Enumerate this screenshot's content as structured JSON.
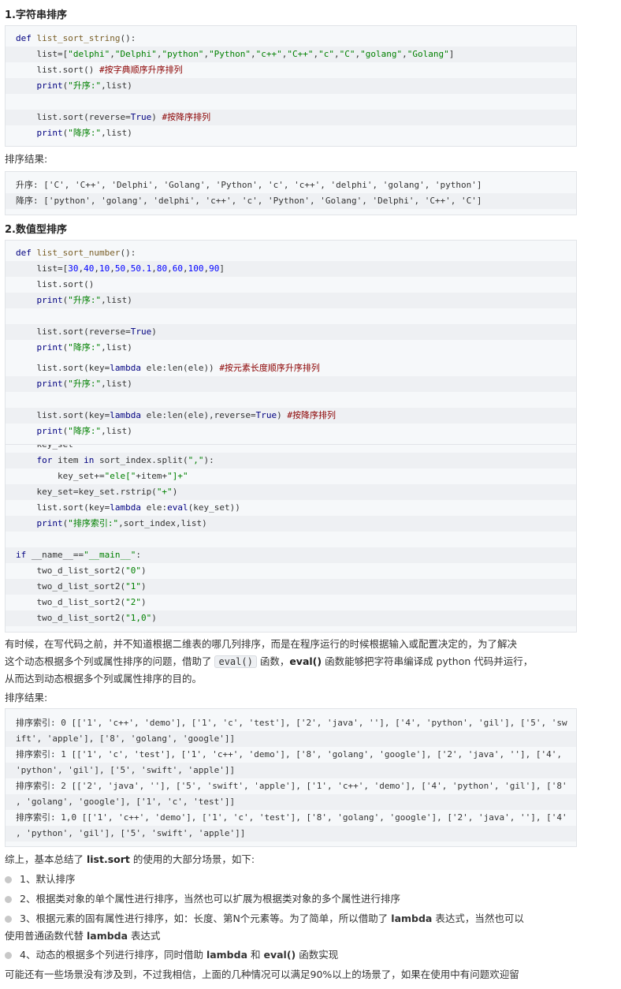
{
  "heading1": "1.字符串排序",
  "code1": [
    {
      "parts": [
        [
          "kw",
          "def "
        ],
        [
          "fn",
          "list_sort_string"
        ],
        [
          "",
          "():"
        ]
      ]
    },
    {
      "parts": [
        [
          "",
          "    list=["
        ],
        [
          "str",
          "\"delphi\""
        ],
        [
          "",
          ","
        ],
        [
          "str",
          "\"Delphi\""
        ],
        [
          "",
          ","
        ],
        [
          "str",
          "\"python\""
        ],
        [
          "",
          ","
        ],
        [
          "str",
          "\"Python\""
        ],
        [
          "",
          ","
        ],
        [
          "str",
          "\"c++\""
        ],
        [
          "",
          ","
        ],
        [
          "str",
          "\"C++\""
        ],
        [
          "",
          ","
        ],
        [
          "str",
          "\"c\""
        ],
        [
          "",
          ","
        ],
        [
          "str",
          "\"C\""
        ],
        [
          "",
          ","
        ],
        [
          "str",
          "\"golang\""
        ],
        [
          "",
          ","
        ],
        [
          "str",
          "\"Golang\""
        ],
        [
          "",
          "]"
        ]
      ]
    },
    {
      "parts": [
        [
          "",
          "    list.sort() "
        ],
        [
          "com",
          "#按字典顺序升序排列"
        ]
      ]
    },
    {
      "parts": [
        [
          "bi",
          "    print"
        ],
        [
          "",
          "("
        ],
        [
          "str",
          "\"升序:\""
        ],
        [
          "",
          ",list)"
        ]
      ]
    },
    {
      "parts": [
        [
          "",
          ""
        ]
      ]
    },
    {
      "parts": [
        [
          "",
          "    list.sort(reverse="
        ],
        [
          "kw",
          "True"
        ],
        [
          "",
          ") "
        ],
        [
          "com",
          "#按降序排列"
        ]
      ]
    },
    {
      "parts": [
        [
          "bi",
          "    print"
        ],
        [
          "",
          "("
        ],
        [
          "str",
          "\"降序:\""
        ],
        [
          "",
          ",list)"
        ]
      ]
    }
  ],
  "result_label1": "排序结果:",
  "output1": [
    "升序: ['C', 'C++', 'Delphi', 'Golang', 'Python', 'c', 'c++', 'delphi', 'golang', 'python']",
    "降序: ['python', 'golang', 'delphi', 'c++', 'c', 'Python', 'Golang', 'Delphi', 'C++', 'C']"
  ],
  "heading2": "2.数值型排序",
  "code2": [
    {
      "parts": [
        [
          "kw",
          "def "
        ],
        [
          "fn",
          "list_sort_number"
        ],
        [
          "",
          "():"
        ]
      ]
    },
    {
      "parts": [
        [
          "",
          "    list=["
        ],
        [
          "num",
          "30"
        ],
        [
          "",
          ","
        ],
        [
          "num",
          "40"
        ],
        [
          "",
          ","
        ],
        [
          "num",
          "10"
        ],
        [
          "",
          ","
        ],
        [
          "num",
          "50"
        ],
        [
          "",
          ","
        ],
        [
          "num",
          "50.1"
        ],
        [
          "",
          ","
        ],
        [
          "num",
          "80"
        ],
        [
          "",
          ","
        ],
        [
          "num",
          "60"
        ],
        [
          "",
          ","
        ],
        [
          "num",
          "100"
        ],
        [
          "",
          ","
        ],
        [
          "num",
          "90"
        ],
        [
          "",
          "]"
        ]
      ]
    },
    {
      "parts": [
        [
          "",
          "    list.sort()"
        ]
      ]
    },
    {
      "parts": [
        [
          "bi",
          "    print"
        ],
        [
          "",
          "("
        ],
        [
          "str",
          "\"升序:\""
        ],
        [
          "",
          ",list)"
        ]
      ]
    },
    {
      "parts": [
        [
          "",
          ""
        ]
      ]
    },
    {
      "parts": [
        [
          "",
          "    list.sort(reverse="
        ],
        [
          "kw",
          "True"
        ],
        [
          "",
          ")"
        ]
      ]
    },
    {
      "parts": [
        [
          "bi",
          "    print"
        ],
        [
          "",
          "("
        ],
        [
          "str",
          "\"降序:\""
        ],
        [
          "",
          ",list)"
        ]
      ]
    }
  ],
  "code2b": [
    {
      "parts": [
        [
          "",
          "    list.sort(key="
        ],
        [
          "kw",
          "lambda"
        ],
        [
          "",
          " ele:len(ele)) "
        ],
        [
          "com",
          "#按元素长度顺序升序排列"
        ]
      ]
    },
    {
      "parts": [
        [
          "bi",
          "    print"
        ],
        [
          "",
          "("
        ],
        [
          "str",
          "\"升序:\""
        ],
        [
          "",
          ",list)"
        ]
      ]
    },
    {
      "parts": [
        [
          "",
          ""
        ]
      ]
    },
    {
      "parts": [
        [
          "",
          "    list.sort(key="
        ],
        [
          "kw",
          "lambda"
        ],
        [
          "",
          " ele:len(ele),reverse="
        ],
        [
          "kw",
          "True"
        ],
        [
          "",
          ") "
        ],
        [
          "com",
          "#按降序排列"
        ]
      ]
    },
    {
      "parts": [
        [
          "bi",
          "    print"
        ],
        [
          "",
          "("
        ],
        [
          "str",
          "\"降序:\""
        ],
        [
          "",
          ",list)"
        ]
      ]
    }
  ],
  "code3": [
    {
      "parts": [
        [
          "",
          "    key_set"
        ]
      ]
    },
    {
      "parts": [
        [
          "kw",
          "    for"
        ],
        [
          "",
          " item "
        ],
        [
          "kw",
          "in"
        ],
        [
          "",
          " sort_index.split("
        ],
        [
          "str",
          "\",\""
        ],
        [
          "",
          "):"
        ]
      ]
    },
    {
      "parts": [
        [
          "",
          "        key_set+="
        ],
        [
          "str",
          "\"ele[\""
        ],
        [
          "",
          "+item+"
        ],
        [
          "str",
          "\"]+\""
        ]
      ]
    },
    {
      "parts": [
        [
          "",
          "    key_set=key_set.rstrip("
        ],
        [
          "str",
          "\"+\""
        ],
        [
          "",
          ")"
        ]
      ]
    },
    {
      "parts": [
        [
          "",
          "    list.sort(key="
        ],
        [
          "kw",
          "lambda"
        ],
        [
          "",
          " ele:"
        ],
        [
          "bi",
          "eval"
        ],
        [
          "",
          "(key_set))"
        ]
      ]
    },
    {
      "parts": [
        [
          "bi",
          "    print"
        ],
        [
          "",
          "("
        ],
        [
          "str",
          "\"排序索引:\""
        ],
        [
          "",
          ",sort_index,list)"
        ]
      ]
    },
    {
      "parts": [
        [
          "",
          ""
        ]
      ]
    },
    {
      "parts": [
        [
          "kw",
          "if"
        ],
        [
          "",
          " __name__=="
        ],
        [
          "str",
          "\"__main__\""
        ],
        [
          "",
          ":"
        ]
      ]
    },
    {
      "parts": [
        [
          "",
          "    two_d_list_sort2("
        ],
        [
          "str",
          "\"0\""
        ],
        [
          "",
          ")"
        ]
      ]
    },
    {
      "parts": [
        [
          "",
          "    two_d_list_sort2("
        ],
        [
          "str",
          "\"1\""
        ],
        [
          "",
          ")"
        ]
      ]
    },
    {
      "parts": [
        [
          "",
          "    two_d_list_sort2("
        ],
        [
          "str",
          "\"2\""
        ],
        [
          "",
          ")"
        ]
      ]
    },
    {
      "parts": [
        [
          "",
          "    two_d_list_sort2("
        ],
        [
          "str",
          "\"1,0\""
        ],
        [
          "",
          ")"
        ]
      ]
    }
  ],
  "para1": {
    "line1": "有时候，在写代码之前，并不知道根据二维表的哪几列排序，而是在程序运行的时候根据输入或配置决定的，为了解决",
    "line2_a": "这个动态根据多个列或属性排序的问题，借助了 ",
    "inline_code": "eval()",
    "line2_b": " 函数，",
    "line2_bold": "eval()",
    "line2_c": " 函数能够把字符串编译成 python 代码并运行，",
    "line3": "从而达到动态根据多个列或属性排序的目的。"
  },
  "result_label2": "排序结果:",
  "output2": [
    "排序索引: 0 [['1', 'c++', 'demo'], ['1', 'c', 'test'], ['2', 'java', ''], ['4', 'python', 'gil'], ['5', 'sw",
    "ift', 'apple'], ['8', 'golang', 'google']]",
    "排序索引: 1 [['1', 'c', 'test'], ['1', 'c++', 'demo'], ['8', 'golang', 'google'], ['2', 'java', ''], ['4',",
    "'python', 'gil'], ['5', 'swift', 'apple']]",
    "排序索引: 2 [['2', 'java', ''], ['5', 'swift', 'apple'], ['1', 'c++', 'demo'], ['4', 'python', 'gil'], ['8'",
    ", 'golang', 'google'], ['1', 'c', 'test']]",
    "排序索引: 1,0 [['1', 'c++', 'demo'], ['1', 'c', 'test'], ['8', 'golang', 'google'], ['2', 'java', ''], ['4'",
    ", 'python', 'gil'], ['5', 'swift', 'apple']]"
  ],
  "summary": {
    "prefix": "综上，基本总结了 ",
    "bold": "list.sort",
    "suffix": " 的使用的大部分场景，如下:"
  },
  "list_items": {
    "item1": "1、默认排序",
    "item2": "2、根据类对象的单个属性进行排序，当然也可以扩展为根据类对象的多个属性进行排序",
    "item3_a": "3、根据元素的固有属性进行排序，如：长度、第N个元素等。为了简单，所以借助了 ",
    "item3_bold": "lambda",
    "item3_b": " 表达式，当然也可以",
    "item3_c": "使用普通函数代替 ",
    "item3_bold2": "lambda",
    "item3_d": " 表达式",
    "item4_a": "4、动态的根据多个列进行排序，同时借助 ",
    "item4_bold": "lambda",
    "item4_b": " 和 ",
    "item4_bold2": "eval()",
    "item4_c": " 函数实现"
  },
  "closing": "可能还有一些场景没有涉及到，不过我相信，上面的几种情况可以满足90%以上的场景了，如果在使用中有问题欢迎留"
}
